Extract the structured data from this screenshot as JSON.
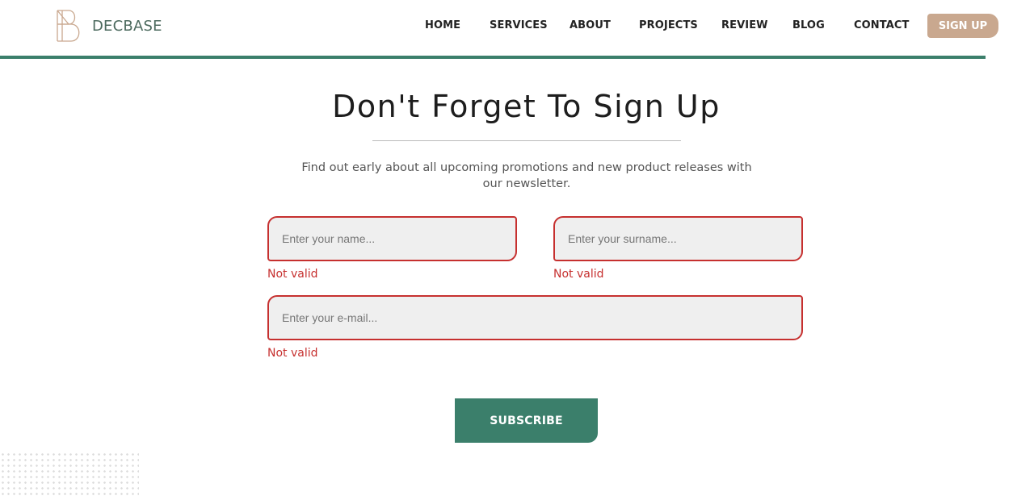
{
  "brand": {
    "name": "DECBASE",
    "logo_icon": "b-monogram-logo"
  },
  "nav": {
    "items": [
      {
        "label": "HOME"
      },
      {
        "label": "SERVICES"
      },
      {
        "label": "ABOUT"
      },
      {
        "label": "PROJECTS"
      },
      {
        "label": "REVIEW"
      },
      {
        "label": "BLOG"
      },
      {
        "label": "CONTACT"
      }
    ],
    "signup_label": "SIGN UP"
  },
  "newsletter": {
    "title": "Don't Forget To Sign Up",
    "subtitle": "Find out early about all upcoming promotions and new product releases with our newsletter.",
    "fields": {
      "name": {
        "placeholder": "Enter your name...",
        "value": "",
        "error": "Not valid"
      },
      "surname": {
        "placeholder": "Enter your surname...",
        "value": "",
        "error": "Not valid"
      },
      "email": {
        "placeholder": "Enter your e-mail...",
        "value": "",
        "error": "Not valid"
      }
    },
    "subscribe_label": "SUBSCRIBE"
  },
  "colors": {
    "brand_green": "#3b7f6b",
    "accent_tan": "#c9a88f",
    "error_red": "#c6302f",
    "field_bg": "#efefef"
  }
}
